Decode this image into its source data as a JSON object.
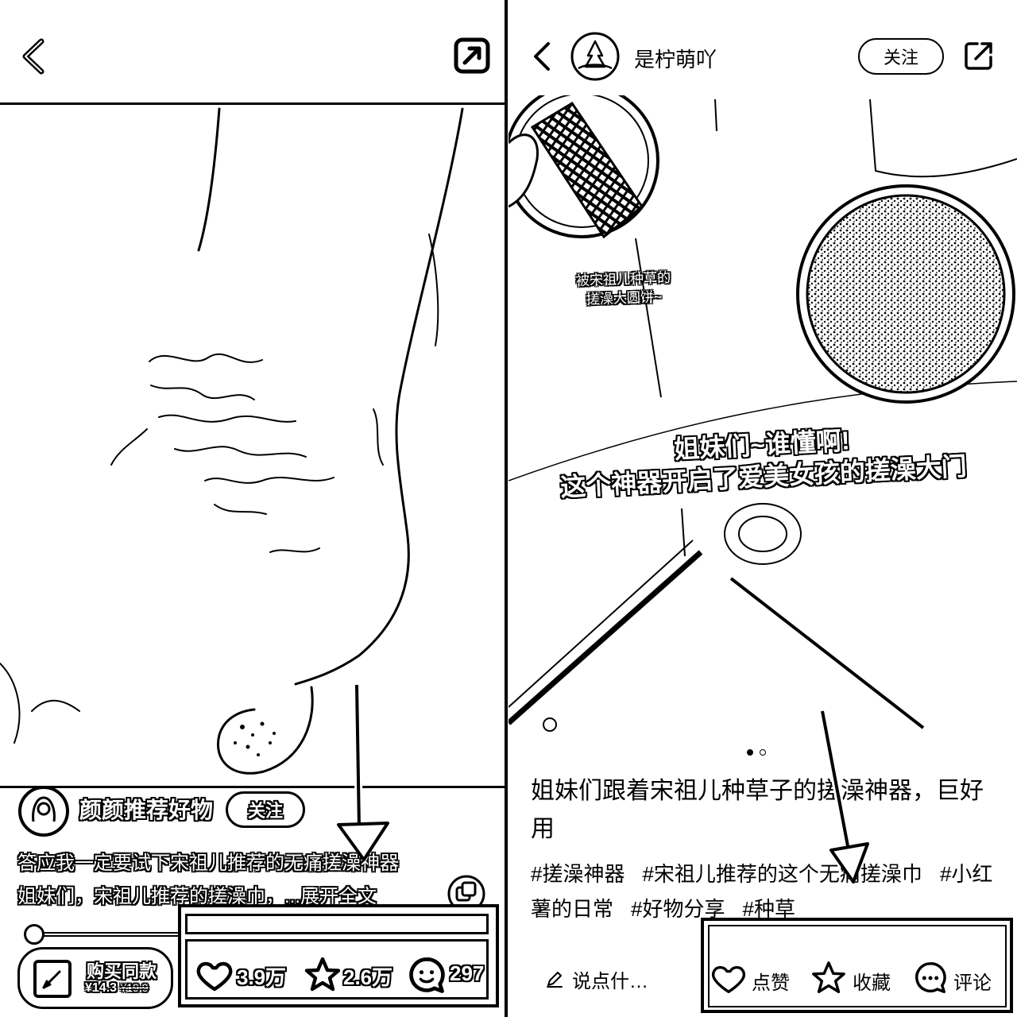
{
  "colors": {
    "foreground": "#000000",
    "background": "#ffffff"
  },
  "left_panel": {
    "header": {
      "back_icon": "chevron-left-icon",
      "share_icon": "share-icon"
    },
    "author": {
      "name": "颜颜推荐好物",
      "follow_label": "关注"
    },
    "caption": {
      "line1": "答应我一定要试下宋祖儿推荐的无痛搓澡神器",
      "line2": "姐妹们，宋祖儿推荐的搓澡巾，",
      "expand": "...展开全文"
    },
    "buy": {
      "label": "购买同款",
      "price": "¥14.3",
      "original_price": "¥19.9"
    },
    "stats": {
      "likes": "3.9万",
      "favorites": "2.6万",
      "comments": "297"
    }
  },
  "right_panel": {
    "header": {
      "author_name": "是柠萌吖",
      "follow_label": "关注"
    },
    "image": {
      "caption_small_line1": "被宋祖儿种草的",
      "caption_small_line2": "搓澡大圆饼~",
      "overlay_line1": "姐妹们~谁懂啊!",
      "overlay_line2": "这个神器开启了爱美女孩的搓澡大门"
    },
    "carousel": {
      "total": 2,
      "current": 1
    },
    "title": "姐妹们跟着宋祖儿种草子的搓澡神器，巨好用",
    "tags": [
      "#搓澡神器",
      "#宋祖儿推荐的这个无痛搓澡巾",
      "#小红薯的日常",
      "#好物分享",
      "#种草"
    ],
    "bottom_bar": {
      "comment_placeholder": "说点什…",
      "like_label": "点赞",
      "favorite_label": "收藏",
      "comment_label": "评论"
    }
  }
}
